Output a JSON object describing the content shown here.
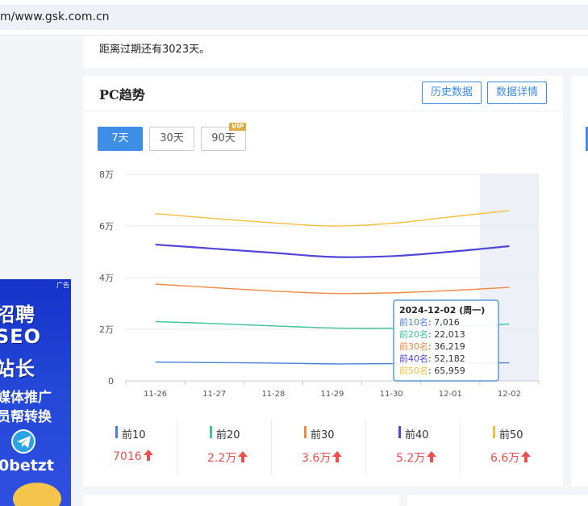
{
  "browser": {
    "url": "m/www.gsk.com.cn"
  },
  "notice": {
    "text": "距离过期还有3023天。"
  },
  "ad": {
    "tag": "广告",
    "line1": "招聘",
    "line2": "SEO",
    "line3": "站长",
    "line4": "媒体推广",
    "line5": "员帮转换",
    "handle": "0betzt",
    "icon": "telegram-icon"
  },
  "panel": {
    "title": "PC趋势",
    "history_button": "历史数据",
    "detail_button": "数据详情",
    "ranges": [
      "7天",
      "30天",
      "90天"
    ],
    "active_range": "7天",
    "vip_badge": "VIP"
  },
  "chart_data": {
    "type": "line",
    "x": [
      "11-26",
      "11-27",
      "11-28",
      "11-29",
      "11-30",
      "12-01",
      "12-02"
    ],
    "y_ticks": [
      "0",
      "2万",
      "4万",
      "6万",
      "8万"
    ],
    "ylim": [
      0,
      80000
    ],
    "series": [
      {
        "name": "前10",
        "color": "#4a7fdc",
        "values": [
          7300,
          7100,
          6900,
          6600,
          6700,
          6900,
          7016
        ]
      },
      {
        "name": "前20",
        "color": "#3cc39a",
        "values": [
          23000,
          22200,
          21300,
          20500,
          20400,
          21000,
          22013
        ]
      },
      {
        "name": "前30",
        "color": "#f08a43",
        "values": [
          37500,
          36100,
          34800,
          33900,
          34100,
          35000,
          36219
        ]
      },
      {
        "name": "前40",
        "color": "#5146d8",
        "values": [
          52800,
          51200,
          49600,
          48000,
          48300,
          50000,
          52182
        ]
      },
      {
        "name": "前50",
        "color": "#f2c13c",
        "values": [
          64800,
          62900,
          61200,
          60000,
          61000,
          63500,
          65959
        ]
      }
    ],
    "grid": true,
    "highlight_index": 6,
    "tooltip": {
      "date": "2024-12-02",
      "weekday": "(周一)",
      "rows": [
        {
          "label": "前10名",
          "value": "7,016",
          "color": "#4a7fdc"
        },
        {
          "label": "前20名",
          "value": "22,013",
          "color": "#3cc39a"
        },
        {
          "label": "前30名",
          "value": "36,219",
          "color": "#f08a43"
        },
        {
          "label": "前40名",
          "value": "52,182",
          "color": "#5146d8"
        },
        {
          "label": "前50名",
          "value": "65,959",
          "color": "#f2c13c"
        }
      ]
    }
  },
  "stats": [
    {
      "label": "前10",
      "value": "7016",
      "color": "#4a7fdc"
    },
    {
      "label": "前20",
      "value": "2.2万",
      "color": "#3cc39a"
    },
    {
      "label": "前30",
      "value": "3.6万",
      "color": "#f08a43"
    },
    {
      "label": "前40",
      "value": "5.2万",
      "color": "#5146d8"
    },
    {
      "label": "前50",
      "value": "6.6万",
      "color": "#f2c13c"
    }
  ],
  "colors": {
    "accent": "#3e8ee8",
    "up": "#ee4f4f"
  }
}
